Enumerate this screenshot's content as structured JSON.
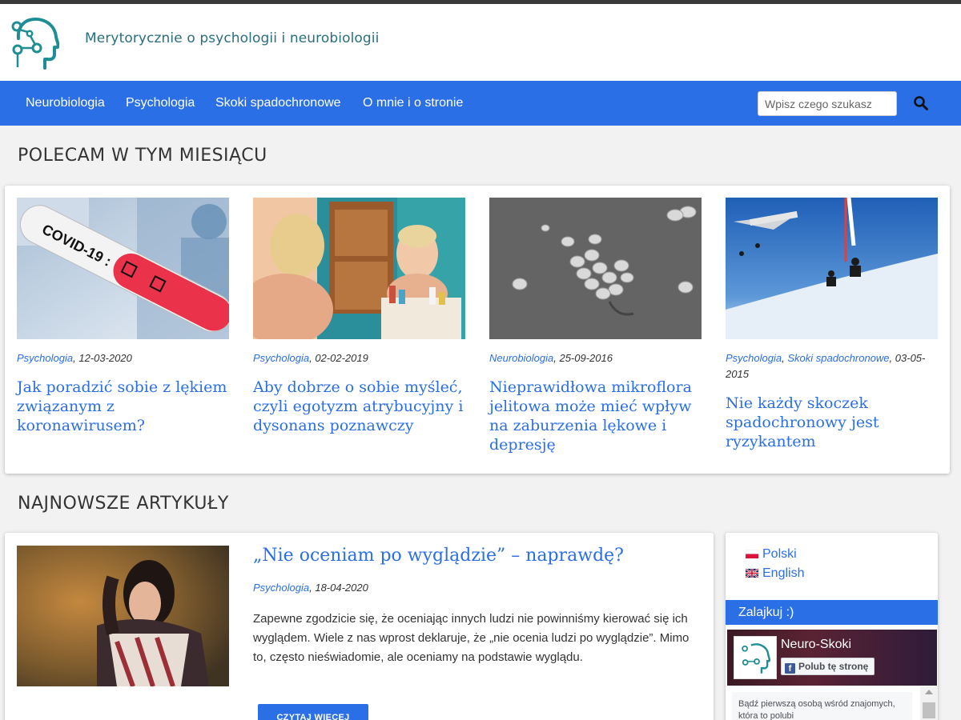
{
  "header": {
    "tagline": "Merytorycznie o psychologii i neurobiologii"
  },
  "nav": {
    "items": [
      "Neurobiologia",
      "Psychologia",
      "Skoki spadochronowe",
      "O mnie i o stronie"
    ],
    "search_placeholder": "Wpisz czego szukasz"
  },
  "featured": {
    "title": "POLECAM W TYM MIESIĄCU",
    "cards": [
      {
        "categories": [
          "Psychologia"
        ],
        "date": "12-03-2020",
        "title": "Jak poradzić sobie z lękiem związanym z koronawirusem?",
        "image": "covid-test-tube"
      },
      {
        "categories": [
          "Psychologia"
        ],
        "date": "02-02-2019",
        "title": "Aby dobrze o sobie myśleć, czyli egotyzm atrybucyjny i dysonans poznawczy",
        "image": "woman-mirror"
      },
      {
        "categories": [
          "Neurobiologia"
        ],
        "date": "25-09-2016",
        "title": "Nieprawidłowa mikroflora jelitowa może mieć wpływ na zaburzenia lękowe i depresję",
        "image": "bacteria-microscope"
      },
      {
        "categories": [
          "Psychologia",
          "Skoki spadochronowe"
        ],
        "date": "03-05-2015",
        "title": "Nie każdy skoczek spadochronowy jest ryzykantem",
        "image": "skydivers"
      }
    ]
  },
  "latest": {
    "title": "NAJNOWSZE ARTYKUŁY",
    "article": {
      "title": "„Nie oceniam po wyglądzie” – naprawdę?",
      "category": "Psychologia",
      "date": "18-04-2020",
      "excerpt": "Zapewne zgodzicie się, że oceniając innych ludzi nie powinniśmy kierować się ich wyglądem. Wiele z nas wprost deklaruje, że „nie ocenia ludzi po wyglądzie”. Mimo to, często nieświadomie, ale oceniamy na podstawie wyglądu.",
      "read_more": "CZYTAJ WIĘCEJ",
      "image": "woman-portrait"
    }
  },
  "sidebar": {
    "languages": [
      {
        "label": "Polski",
        "flag": "pl-flag-icon"
      },
      {
        "label": "English",
        "flag": "gb-flag-icon"
      }
    ],
    "widget_title": "Zalajkuj :)",
    "facebook": {
      "page_name": "Neuro-Skoki",
      "like_label": "Polub tę stronę",
      "friends_text": "Bądź pierwszą osobą wśród znajomych, która to polubi"
    }
  },
  "colors": {
    "accent": "#2a6fe6",
    "tagline": "#2a6f80",
    "logo": "#1f8e94"
  }
}
